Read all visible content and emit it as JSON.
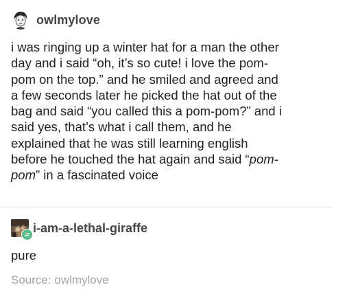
{
  "post": {
    "author": "owlmylove",
    "lines": [
      "i was ringing up a winter hat for a man the other",
      "day and i said “oh, it’s so cute! i love the pom-",
      "pom on the top.” and he smiled and agreed and",
      "a few seconds later he picked the hat out of the",
      "bag and said “you called this a pom-pom?” and i",
      "said yes, that’s what i call them, and he",
      "explained that he was still learning english",
      "before he touched the hat again and said “"
    ],
    "last_line_italic_1": "pom-",
    "last_line_italic_2": "pom",
    "last_line_end": "” in a fascinated voice"
  },
  "reblog": {
    "author": "i-am-a-lethal-giraffe",
    "text": "pure",
    "badge_icon": "reblog-icon",
    "badge_color": "#56bc8a"
  },
  "source": {
    "label": "Source: ",
    "name": "owlmylove"
  }
}
